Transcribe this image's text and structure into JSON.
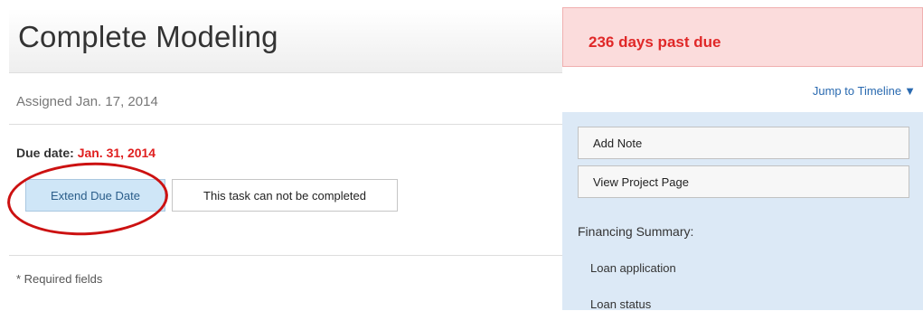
{
  "header": {
    "title": "Complete Modeling"
  },
  "task": {
    "assigned": "Assigned Jan. 17, 2014",
    "due_label": "Due date:",
    "due_value": "Jan. 31, 2014",
    "extend_button": "Extend Due Date",
    "cannot_complete_button": "This task can not be completed",
    "required_note": "* Required fields"
  },
  "status": {
    "past_due": "236 days past due"
  },
  "sidebar": {
    "jump_link": "Jump to Timeline",
    "jump_icon": "▼",
    "add_note": "Add Note",
    "view_project": "View Project Page",
    "financing_summary": "Financing Summary:",
    "items": [
      {
        "label": "Loan application"
      },
      {
        "label": "Loan status"
      }
    ]
  },
  "colors": {
    "past_due_bg": "#fbdcdc",
    "past_due_text": "#e02828",
    "due_date_text": "#e02020",
    "extend_button_bg": "#cfe6f7",
    "sidebar_bg": "#dce9f6",
    "annotation_circle": "#cc1111",
    "link": "#2a6ab0"
  }
}
